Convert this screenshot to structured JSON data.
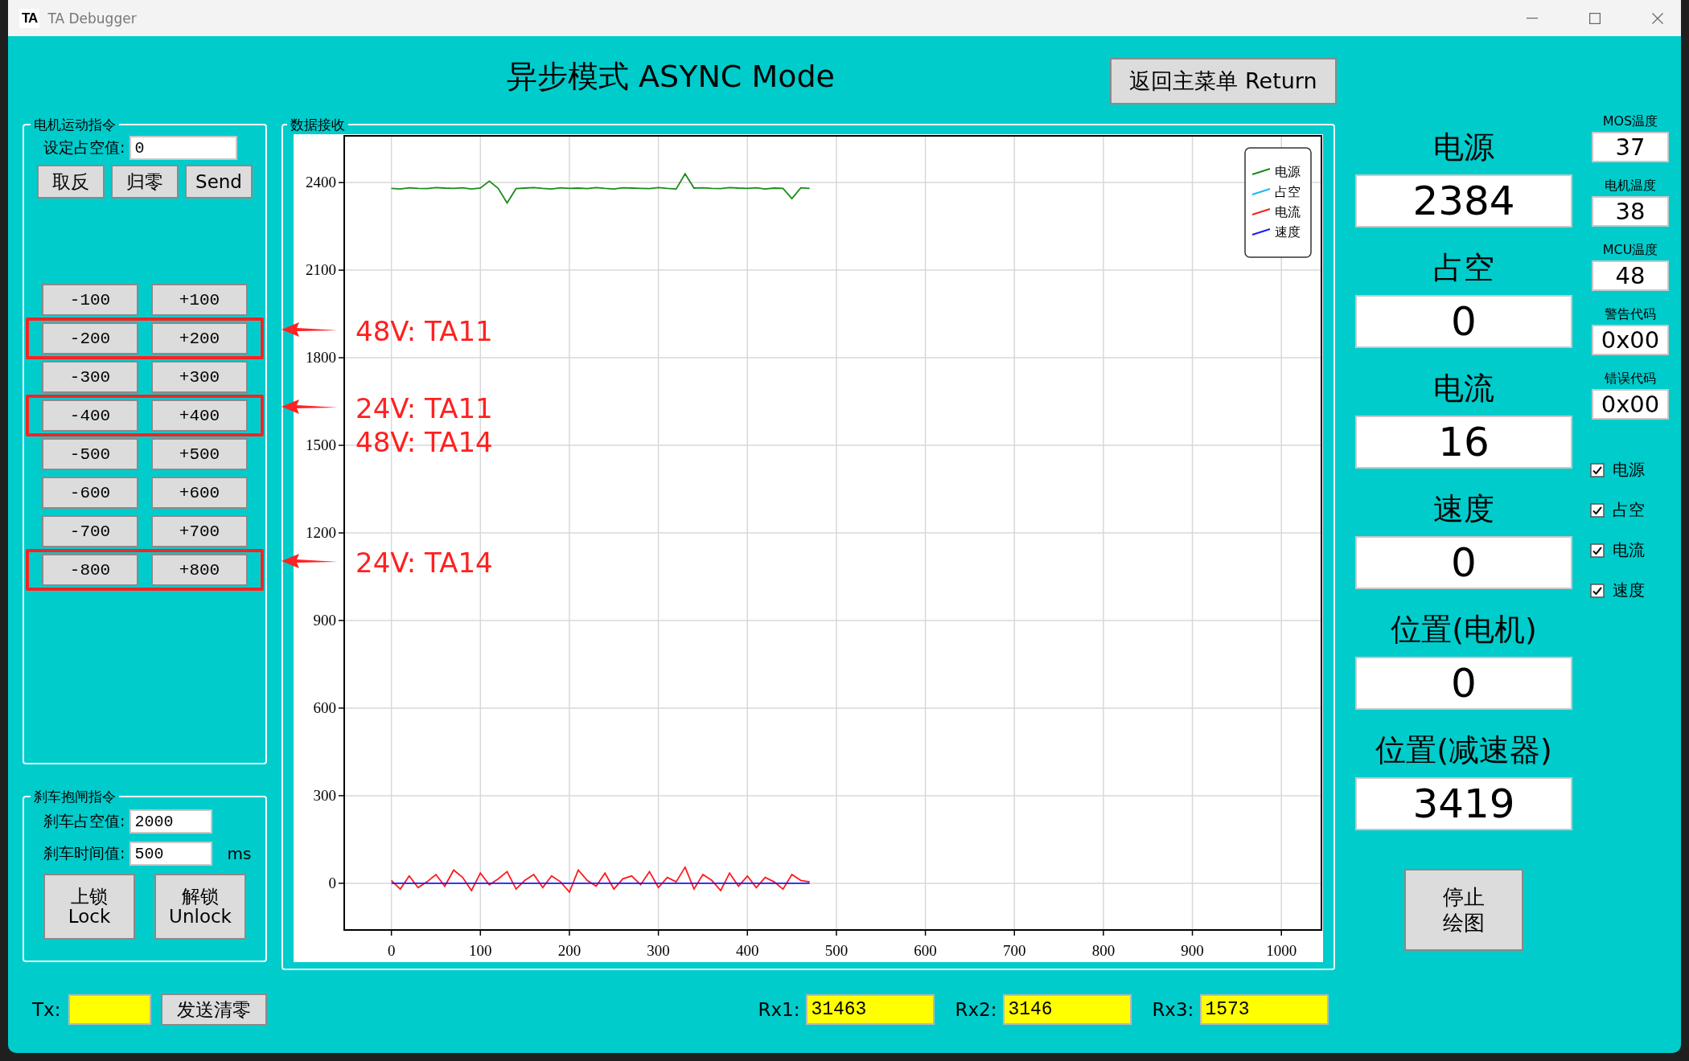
{
  "window": {
    "icon": "TA",
    "title": "TA Debugger"
  },
  "header": {
    "title": "异步模式 ASYNC Mode",
    "return_button": "返回主菜单 Return"
  },
  "motion_group": {
    "title": "电机运动指令",
    "duty_label": "设定占空值:",
    "duty_value": "0",
    "buttons": [
      "取反",
      "归零",
      "Send"
    ],
    "steps": [
      {
        "minus": "-100",
        "plus": "+100",
        "highlighted": false
      },
      {
        "minus": "-200",
        "plus": "+200",
        "highlighted": true,
        "note": [
          "48V: TA11"
        ]
      },
      {
        "minus": "-300",
        "plus": "+300",
        "highlighted": false
      },
      {
        "minus": "-400",
        "plus": "+400",
        "highlighted": true,
        "note": [
          "24V: TA11",
          "48V: TA14"
        ]
      },
      {
        "minus": "-500",
        "plus": "+500",
        "highlighted": false
      },
      {
        "minus": "-600",
        "plus": "+600",
        "highlighted": false
      },
      {
        "minus": "-700",
        "plus": "+700",
        "highlighted": false
      },
      {
        "minus": "-800",
        "plus": "+800",
        "highlighted": true,
        "note": [
          "24V: TA14"
        ]
      }
    ]
  },
  "brake_group": {
    "title": "刹车抱闸指令",
    "fields": [
      {
        "label": "刹车占空值:",
        "value": "2000"
      },
      {
        "label": "刹车时间值:",
        "value": "500",
        "unit": "ms"
      }
    ],
    "buttons": [
      {
        "lines": [
          "上锁",
          "Lock"
        ]
      },
      {
        "lines": [
          "解锁",
          "Unlock"
        ]
      }
    ]
  },
  "data_group": {
    "title": "数据接收",
    "chart_data": {
      "type": "line",
      "x": [
        0,
        10,
        20,
        30,
        40,
        50,
        60,
        70,
        80,
        90,
        100,
        110,
        120,
        130,
        140,
        150,
        160,
        170,
        180,
        190,
        200,
        210,
        220,
        230,
        240,
        250,
        260,
        270,
        280,
        290,
        300,
        310,
        320,
        330,
        340,
        350,
        360,
        370,
        380,
        390,
        400,
        410,
        420,
        430,
        440,
        450,
        460,
        470
      ],
      "series": [
        {
          "name": "电源",
          "color": "#1a8c1a",
          "values": [
            2380,
            2378,
            2382,
            2380,
            2379,
            2383,
            2381,
            2380,
            2382,
            2378,
            2381,
            2405,
            2380,
            2330,
            2379,
            2381,
            2383,
            2380,
            2378,
            2382,
            2380,
            2381,
            2379,
            2383,
            2380,
            2378,
            2382,
            2381,
            2380,
            2379,
            2383,
            2380,
            2378,
            2430,
            2381,
            2382,
            2380,
            2379,
            2383,
            2381,
            2380,
            2382,
            2378,
            2381,
            2380,
            2345,
            2382,
            2380
          ]
        },
        {
          "name": "占空",
          "color": "#19b8f0",
          "values": [
            null,
            null,
            null,
            null,
            null,
            null,
            null,
            null,
            null,
            null,
            null,
            null,
            null,
            null,
            null,
            null,
            null,
            null,
            null,
            null,
            null,
            null,
            null,
            null,
            null,
            null,
            null,
            null,
            null,
            null,
            null,
            null,
            null,
            null,
            null,
            null,
            null,
            null,
            null,
            null,
            null,
            null,
            null,
            null,
            null,
            null,
            null,
            null
          ]
        },
        {
          "name": "电流",
          "color": "#ff1a1a",
          "values": [
            10,
            -20,
            25,
            -15,
            5,
            30,
            -10,
            45,
            20,
            -25,
            35,
            -5,
            15,
            40,
            -20,
            10,
            30,
            -15,
            25,
            5,
            -30,
            45,
            10,
            -10,
            35,
            -20,
            15,
            25,
            -5,
            40,
            -15,
            20,
            5,
            55,
            -20,
            30,
            10,
            -25,
            35,
            -10,
            25,
            -15,
            20,
            5,
            -20,
            30,
            10,
            5
          ]
        },
        {
          "name": "速度",
          "color": "#1a1aff",
          "values": [
            0,
            0,
            0,
            0,
            0,
            0,
            0,
            0,
            0,
            0,
            0,
            0,
            0,
            0,
            0,
            0,
            0,
            0,
            0,
            0,
            0,
            0,
            0,
            0,
            0,
            0,
            0,
            0,
            0,
            0,
            0,
            0,
            0,
            0,
            0,
            0,
            0,
            0,
            0,
            0,
            0,
            0,
            0,
            0,
            0,
            0,
            0,
            0
          ]
        }
      ],
      "grid": true,
      "legend": true,
      "xlim": [
        -53,
        1045
      ],
      "ylim": [
        -160,
        2560
      ],
      "xticks": [
        0,
        100,
        200,
        300,
        400,
        500,
        600,
        700,
        800,
        900,
        1000
      ],
      "yticks": [
        0,
        300,
        600,
        900,
        1200,
        1500,
        1800,
        2100,
        2400
      ]
    }
  },
  "readouts": [
    {
      "label": "电源",
      "value": "2384"
    },
    {
      "label": "占空",
      "value": "0"
    },
    {
      "label": "电流",
      "value": "16"
    },
    {
      "label": "速度",
      "value": "0"
    },
    {
      "label": "位置(电机)",
      "value": "0"
    },
    {
      "label": "位置(减速器)",
      "value": "3419"
    }
  ],
  "status": [
    {
      "label": "MOS温度",
      "value": "37"
    },
    {
      "label": "电机温度",
      "value": "38"
    },
    {
      "label": "MCU温度",
      "value": "48"
    },
    {
      "label": "警告代码",
      "value": "0x00"
    },
    {
      "label": "错误代码",
      "value": "0x00"
    }
  ],
  "plot_toggles": [
    {
      "label": "电源",
      "checked": true
    },
    {
      "label": "占空",
      "checked": true
    },
    {
      "label": "电流",
      "checked": true
    },
    {
      "label": "速度",
      "checked": true
    }
  ],
  "stop_button": [
    "停止",
    "绘图"
  ],
  "tx": {
    "label": "Tx:",
    "clear_button": "发送清零"
  },
  "rx": [
    {
      "label": "Rx1:",
      "value": "31463"
    },
    {
      "label": "Rx2:",
      "value": "3146"
    },
    {
      "label": "Rx3:",
      "value": "1573"
    }
  ]
}
